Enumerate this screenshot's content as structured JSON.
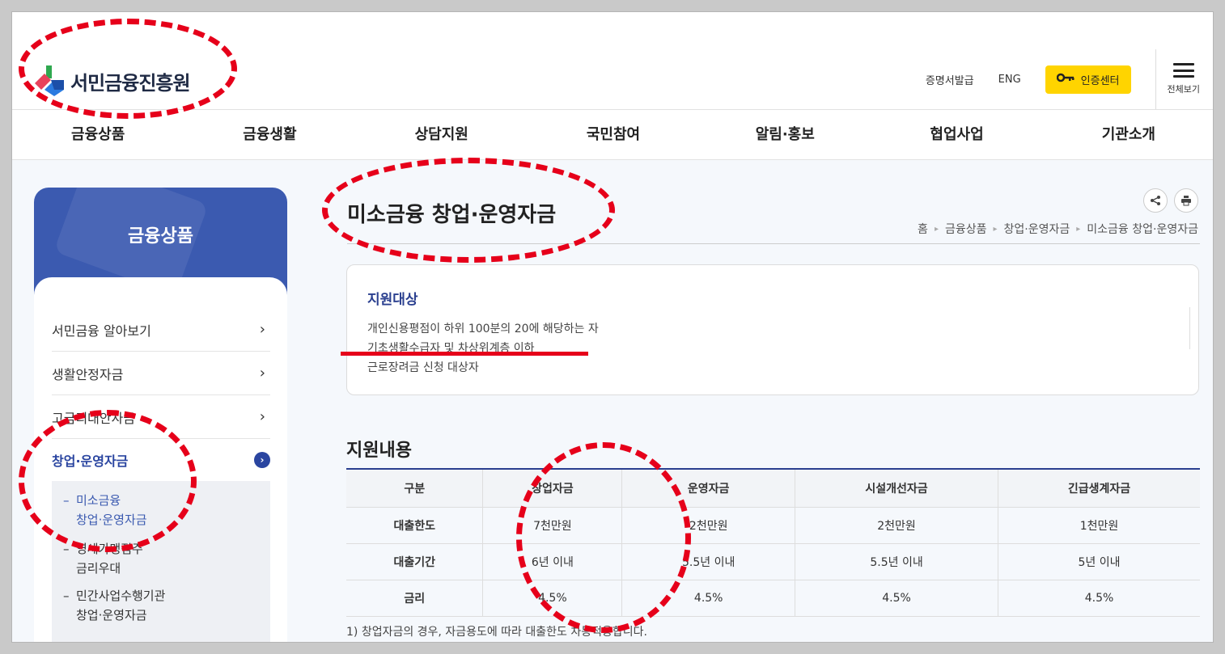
{
  "header": {
    "logo_text": "서민금융진흥원",
    "util": {
      "certificate": "증명서발급",
      "eng": "ENG",
      "auth_center": "인증센터",
      "all_menu": "전체보기"
    }
  },
  "gnb": [
    "금융상품",
    "금융생활",
    "상담지원",
    "국민참여",
    "알림·홍보",
    "협업사업",
    "기관소개"
  ],
  "sidebar": {
    "title": "금융상품",
    "items": [
      {
        "label": "서민금융 알아보기"
      },
      {
        "label": "생활안정자금"
      },
      {
        "label": "고금리대안자금"
      },
      {
        "label": "창업·운영자금"
      }
    ],
    "sub_items": [
      {
        "line1": "미소금융",
        "line2": "창업·운영자금"
      },
      {
        "line1": "영세가맹점주",
        "line2": "금리우대"
      },
      {
        "line1": "민간사업수행기관",
        "line2": "창업·운영자금"
      }
    ],
    "dash": "–"
  },
  "main": {
    "title": "미소금융 창업·운영자금",
    "breadcrumb": [
      "홈",
      "금융상품",
      "창업·운영자금",
      "미소금융 창업·운영자금"
    ],
    "target": {
      "heading": "지원대상",
      "items": [
        "개인신용평점이 하위 100분의 20에 해당하는 자",
        "기초생활수급자 및 차상위계층 이하",
        "근로장려금 신청 대상자"
      ]
    },
    "support_title": "지원내용",
    "table": {
      "headers": [
        "구분",
        "창업자금",
        "운영자금",
        "시설개선자금",
        "긴급생계자금"
      ],
      "rows": [
        [
          "대출한도",
          "7천만원",
          "2천만원",
          "2천만원",
          "1천만원"
        ],
        [
          "대출기간",
          "6년 이내",
          "5.5년 이내",
          "5.5년 이내",
          "5년 이내"
        ],
        [
          "금리",
          "4.5%",
          "4.5%",
          "4.5%",
          "4.5%"
        ]
      ]
    },
    "footnote": "1) 창업자금의 경우, 자금용도에 따라 대출한도 차등적용합니다."
  },
  "colors": {
    "brand_blue": "#3b5ab0",
    "highlight_yellow": "#ffd400",
    "annotation_red": "#e6001a"
  }
}
